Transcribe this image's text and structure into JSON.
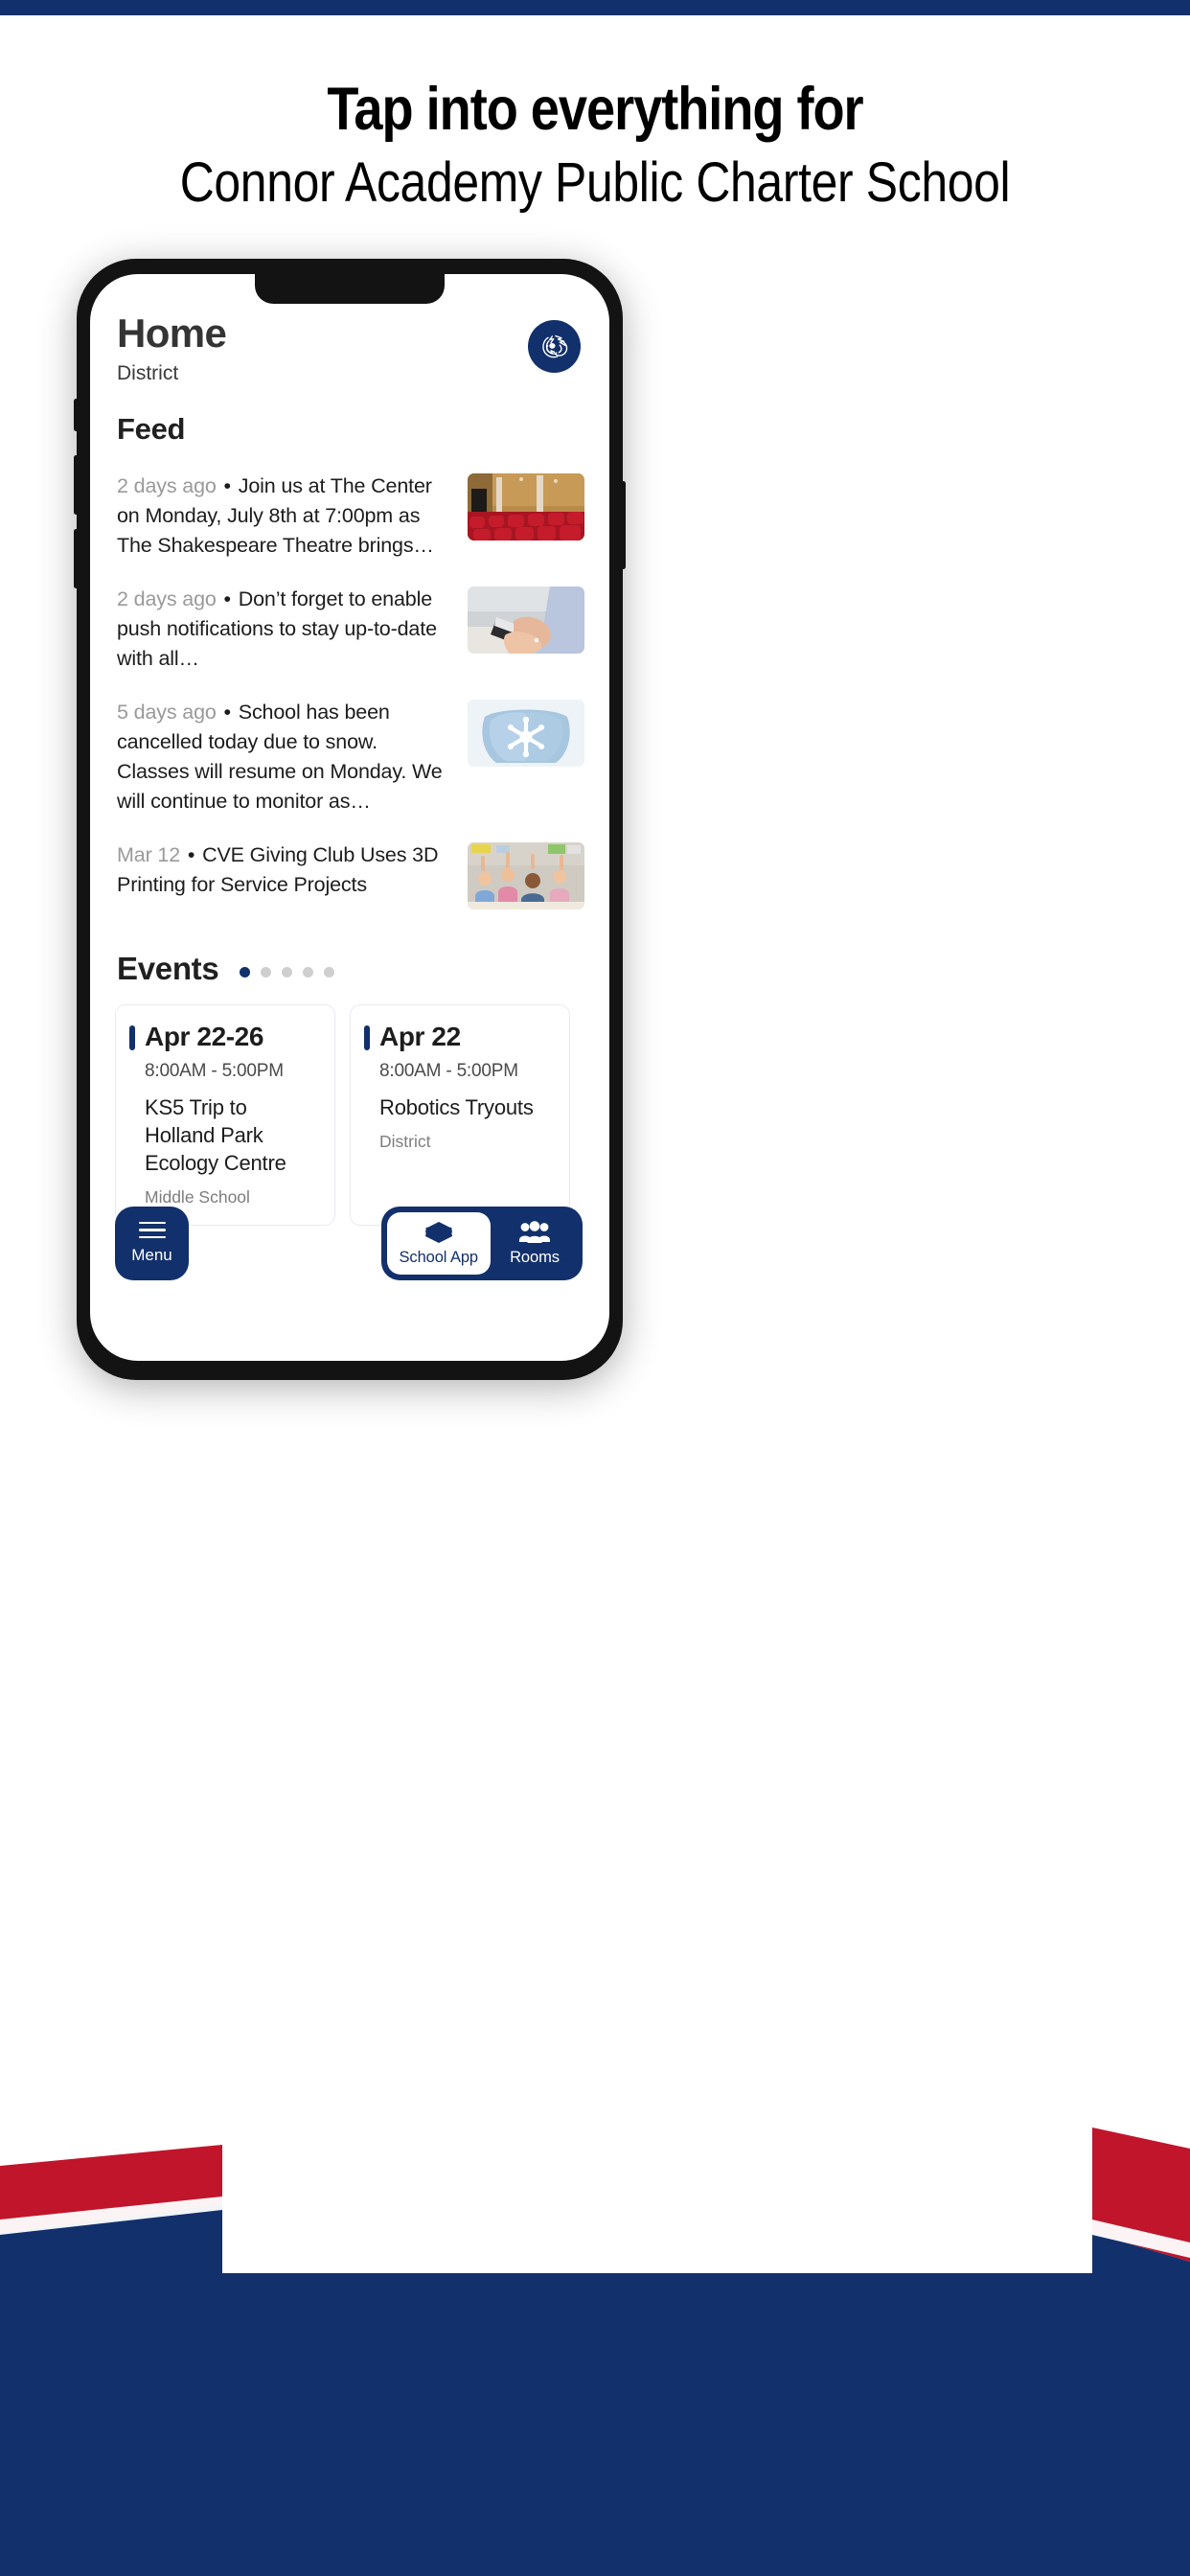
{
  "hero": {
    "line1": "Tap into everything for",
    "line2": "Connor Academy Public Charter School"
  },
  "colors": {
    "navy": "#12306b",
    "red": "#c0152b",
    "white": "#ffffff",
    "text_dark": "#1c1c1c",
    "text_muted": "#9a9a9a"
  },
  "app": {
    "title": "Home",
    "subtitle": "District",
    "logo_icon": "mustang-horse-logo",
    "feed": {
      "title": "Feed",
      "items": [
        {
          "time": "2 days ago",
          "separator": "•",
          "text": "Join us at The Center on Monday, July 8th at 7:00pm as The Shakespeare Theatre brings…",
          "thumb": "theater-red-seats-photo"
        },
        {
          "time": "2 days ago",
          "separator": "•",
          "text": "Don’t forget to enable push notifications to stay up-to-date with all…",
          "thumb": "hands-holding-phone-photo"
        },
        {
          "time": "5 days ago",
          "separator": "•",
          "text": "School has been cancelled today due to snow. Classes will resume on Monday. We will continue to monitor as…",
          "thumb": "snowflake-in-mittens-photo"
        },
        {
          "time": "Mar 12",
          "separator": "•",
          "text": "CVE Giving Club Uses 3D Printing for Service Projects",
          "thumb": "classroom-students-photo"
        }
      ]
    },
    "events": {
      "title": "Events",
      "dots": {
        "count": 5,
        "active_index": 0
      },
      "cards": [
        {
          "date": "Apr 22-26",
          "time": "8:00AM  -  5:00PM",
          "name": "KS5 Trip to Holland Park Ecology Centre",
          "org": "Middle School"
        },
        {
          "date": "Apr 22",
          "time": "8:00AM  -  5:00PM",
          "name": "Robotics Tryouts",
          "org": "District"
        }
      ]
    },
    "bottom_nav": {
      "menu_label": "Menu",
      "menu_icon": "hamburger-icon",
      "segments": [
        {
          "label": "School App",
          "icon": "layers-icon",
          "active": true
        },
        {
          "label": "Rooms",
          "icon": "people-group-icon",
          "active": false
        }
      ]
    }
  }
}
